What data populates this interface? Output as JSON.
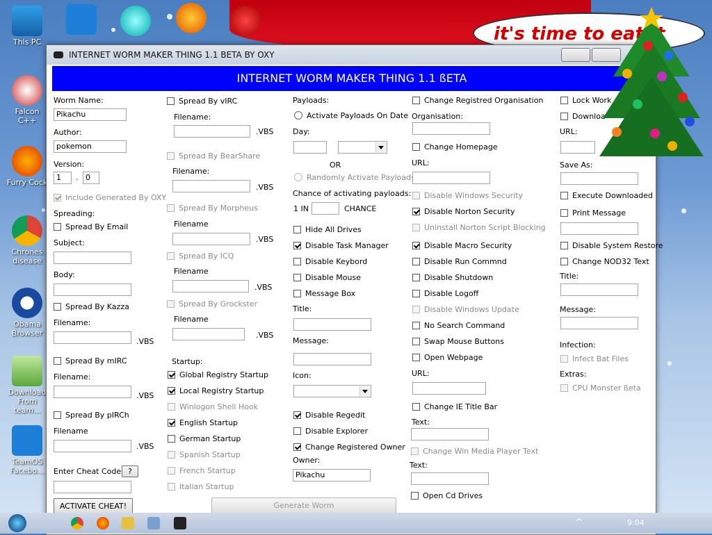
{
  "desktop": {
    "icons": [
      {
        "label": "This PC"
      },
      {
        "label": "Falcon C++"
      },
      {
        "label": "Furry Cock"
      },
      {
        "label": "Chrones disease"
      },
      {
        "label": "Obama Browser"
      },
      {
        "label": "Download From team..."
      },
      {
        "label": "TeamOS Facebo..."
      }
    ],
    "banner_text": "it's time to eat it"
  },
  "window": {
    "title": "INTERNET WORM MAKER THING 1.1 BETA BY OXY",
    "banner": "INTERNET WORM MAKER THING 1.1 ßETA"
  },
  "col1": {
    "worm_name_label": "Worm Name:",
    "worm_name_value": "Pikachu",
    "author_label": "Author:",
    "author_value": "pokemon",
    "version_label": "Version:",
    "version_major": "1",
    "version_dot": ".",
    "version_minor": "0",
    "include_generated": "Include Generated By OXY",
    "spreading_label": "Spreading:",
    "spread_email": "Spread By Email",
    "subject_label": "Subject:",
    "body_label": "Body:",
    "spread_kazza": "Spread By Kazza",
    "filename_label": "Filename:",
    "filename_label_nocolon": "Filename",
    "vbs": ".VBS",
    "spread_mirc": "Spread By mIRC",
    "spread_pirch": "Spread By pIRCh",
    "cheat_label": "Enter Cheat Code!",
    "cheat_help": "?",
    "activate_cheat": "ACTIVATE CHEAT!"
  },
  "col2": {
    "spread_virc": "Spread By vIRC",
    "spread_bearshare": "Spread By BearShare",
    "spread_morpheus": "Spread By Morpheus",
    "spread_icq": "Spread By ICQ",
    "spread_grockster": "Spread By Grockster",
    "startup_label": "Startup:",
    "global_registry": "Global Registry Startup",
    "local_registry": "Local Registry Startup",
    "winlogon": "Winlogon Shell Hook",
    "english": "English Startup",
    "german": "German Startup",
    "spanish": "Spanish Startup",
    "french": "French Startup",
    "italian": "Italian Startup",
    "generate": "Generate Worm"
  },
  "col3": {
    "payloads_label": "Payloads:",
    "activate_on_date": "Activate Payloads On Date",
    "day_label": "Day:",
    "or_label": "OR",
    "random_activate": "Randomly Activate Payloads",
    "chance_label": "Chance of activating payloads:",
    "one_in": "1 IN",
    "chance": "CHANCE",
    "hide_drives": "Hide All Drives",
    "disable_task_manager": "Disable Task Manager",
    "disable_keyboard": "Disable Keybord",
    "disable_mouse": "Disable Mouse",
    "message_box": "Message Box",
    "title_label": "Title:",
    "message_label": "Message:",
    "icon_label": "Icon:",
    "disable_regedit": "Disable Regedit",
    "disable_explorer": "Disable Explorer",
    "change_owner": "Change Registered Owner",
    "owner_label": "Owner:",
    "owner_value": "Pikachu"
  },
  "col4": {
    "change_org": "Change Registred Organisation",
    "org_label": "Organisation:",
    "change_homepage": "Change Homepage",
    "url_label": "URL:",
    "disable_windows_security": "Disable Windows Security",
    "disable_norton": "Disable Norton Security",
    "uninstall_norton": "Uninstall Norton Script Blocking",
    "disable_macro": "Disable Macro Security",
    "disable_run": "Disable Run Commnd",
    "disable_shutdown": "Disable Shutdown",
    "disable_logoff": "Disable Logoff",
    "disable_windows_update": "Disable Windows Update",
    "no_search": "No Search Command",
    "swap_mouse": "Swap Mouse Buttons",
    "open_webpage": "Open Webpage",
    "change_ie_title": "Change IE Title Bar",
    "text_label": "Text:",
    "change_wmp": "Change Win Media Player Text",
    "open_cd": "Open Cd Drives"
  },
  "col5": {
    "lock_work": "Lock Work",
    "download": "Downloa",
    "url_label": "URL:",
    "save_as_label": "Save As:",
    "execute_downloaded": "Execute Downloaded",
    "print_message": "Print Message",
    "disable_system_restore": "Disable System Restore",
    "change_nod32": "Change NOD32 Text",
    "title_label": "Title:",
    "message_label": "Message:",
    "infection_label": "Infection:",
    "infect_bat": "Infect Bat Files",
    "extras_label": "Extras:",
    "cpu_monster": "CPU Monster ßeta"
  },
  "taskbar": {
    "clock": "9:04"
  }
}
